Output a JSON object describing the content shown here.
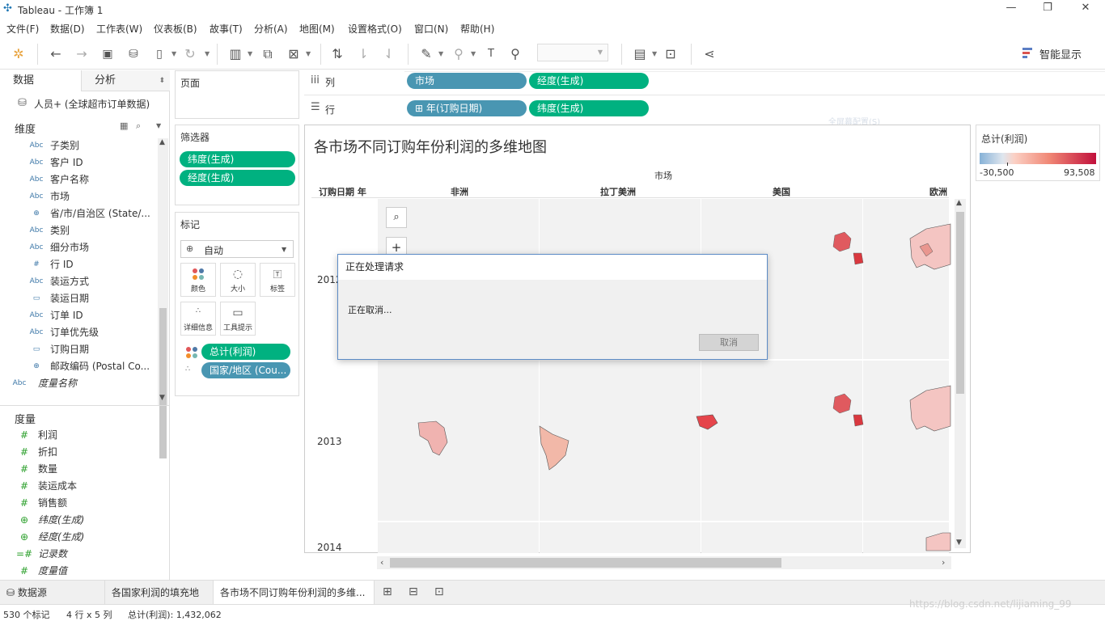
{
  "window": {
    "title": "Tableau - 工作簿 1",
    "controls": [
      "—",
      "❐",
      "✕"
    ]
  },
  "menu": [
    "文件(F)",
    "数据(D)",
    "工作表(W)",
    "仪表板(B)",
    "故事(T)",
    "分析(A)",
    "地图(M)",
    "设置格式(O)",
    "窗口(N)",
    "帮助(H)"
  ],
  "toolbar": {
    "smart_show": "智能显示"
  },
  "left_pane": {
    "tab_data": "数据",
    "tab_analysis": "分析",
    "datasource": "人员+ (全球超市订单数据)",
    "dimensions_title": "维度",
    "dimensions": [
      {
        "icon": "Abc",
        "label": "子类别"
      },
      {
        "icon": "Abc",
        "label": "客户 ID"
      },
      {
        "icon": "Abc",
        "label": "客户名称"
      },
      {
        "icon": "Abc",
        "label": "市场"
      },
      {
        "icon": "globe",
        "label": "省/市/自治区 (State/..."
      },
      {
        "icon": "Abc",
        "label": "类别"
      },
      {
        "icon": "Abc",
        "label": "细分市场"
      },
      {
        "icon": "#",
        "label": "行 ID"
      },
      {
        "icon": "Abc",
        "label": "装运方式"
      },
      {
        "icon": "calendar",
        "label": "装运日期"
      },
      {
        "icon": "Abc",
        "label": "订单 ID"
      },
      {
        "icon": "Abc",
        "label": "订单优先级"
      },
      {
        "icon": "calendar",
        "label": "订购日期"
      },
      {
        "icon": "globe",
        "label": "邮政编码 (Postal Co..."
      }
    ],
    "measure_names": "度量名称",
    "measures_title": "度量",
    "measures": [
      {
        "icon": "#",
        "label": "利润",
        "italic": false
      },
      {
        "icon": "#",
        "label": "折扣",
        "italic": false
      },
      {
        "icon": "#",
        "label": "数量",
        "italic": false
      },
      {
        "icon": "#",
        "label": "装运成本",
        "italic": false
      },
      {
        "icon": "#",
        "label": "销售额",
        "italic": false
      },
      {
        "icon": "globe",
        "label": "纬度(生成)",
        "italic": true
      },
      {
        "icon": "globe",
        "label": "经度(生成)",
        "italic": true
      },
      {
        "icon": "=#",
        "label": "记录数",
        "italic": true
      },
      {
        "icon": "#",
        "label": "度量值",
        "italic": true
      }
    ]
  },
  "shelves": {
    "pages_label": "页面",
    "filters_label": "筛选器",
    "filters": [
      "纬度(生成)",
      "经度(生成)"
    ],
    "marks_label": "标记",
    "mark_type": "自动",
    "mark_buttons": [
      "颜色",
      "大小",
      "标签",
      "详细信息",
      "工具提示"
    ],
    "mark_pills": [
      "总计(利润)",
      "国家/地区 (Cou..."
    ],
    "columns_label": "列",
    "columns": [
      "市场",
      "经度(生成)"
    ],
    "rows_label": "行",
    "rows": [
      "⊞ 年(订购日期)",
      "纬度(生成)"
    ],
    "faded_text": "全屏幕配置(S)"
  },
  "view": {
    "title": "各市场不同订购年份利润的多维地图",
    "market_header": "市场",
    "row_header": "订购日期 年",
    "markets": [
      "非洲",
      "拉丁美洲",
      "美国",
      "欧洲"
    ],
    "years": [
      "2012",
      "2013",
      "2014"
    ]
  },
  "legend": {
    "title": "总计(利润)",
    "min": "-30,500",
    "max": "93,508"
  },
  "dialog": {
    "title": "正在处理请求",
    "message": "正在取消...",
    "cancel": "取消"
  },
  "tabs": {
    "datasource": "数据源",
    "sheets": [
      "各国家利润的填充地图",
      "各市场不同订购年份利润的多维..."
    ]
  },
  "status": {
    "marks": "530 个标记",
    "grid": "4 行 x 5 列",
    "sum": "总计(利润): 1,432,062",
    "watermark": "https://blog.csdn.net/lijiaming_99"
  },
  "colors": {
    "green_pill": "#00b180",
    "blue_pill": "#4996b2",
    "legend_low": "#86b1d7",
    "legend_high": "#c1103c"
  }
}
